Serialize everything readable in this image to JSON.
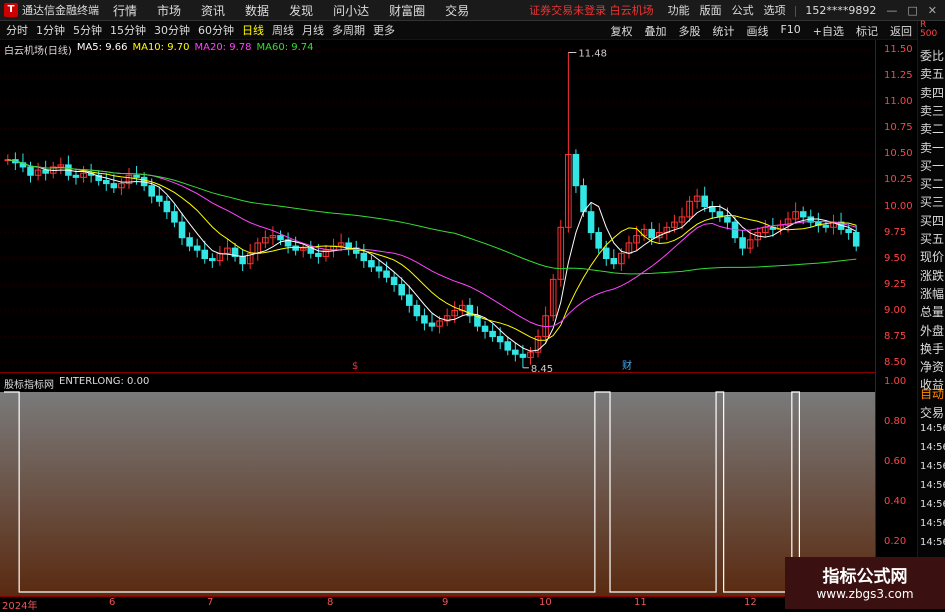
{
  "app": {
    "name": "通达信金融终端",
    "warning": "证券交易未登录",
    "stock_name_top": "白云机场"
  },
  "main_menu": [
    "行情",
    "市场",
    "资讯",
    "数据",
    "发现",
    "问小达",
    "财富圈",
    "交易"
  ],
  "right_menu": [
    "功能",
    "版面",
    "公式",
    "选项"
  ],
  "account": "152****9892",
  "toolbar": {
    "periods": [
      "分时",
      "1分钟",
      "5分钟",
      "15分钟",
      "30分钟",
      "60分钟",
      "日线",
      "周线",
      "月线",
      "多周期",
      "更多"
    ],
    "active": "日线",
    "right_buttons": [
      "复权",
      "叠加",
      "多股",
      "统计",
      "画线",
      "F10",
      "+自选",
      "标记",
      "返回"
    ]
  },
  "legend": {
    "name": "白云机场(日线)",
    "ma5": "MA5: 9.66",
    "ma10": "MA10: 9.70",
    "ma20": "MA20: 9.78",
    "ma60": "MA60: 9.74"
  },
  "sub_legend": {
    "name": "股标指标网",
    "value": "ENTERLONG: 0.00"
  },
  "annotations": {
    "high": "11.48",
    "low": "8.45",
    "marker1": "$",
    "marker2": "财"
  },
  "y_ticks": [
    "11.50",
    "11.25",
    "11.00",
    "10.75",
    "10.50",
    "10.25",
    "10.00",
    "9.75",
    "9.50",
    "9.25",
    "9.00",
    "8.75",
    "8.50"
  ],
  "sub_y_ticks": [
    "1.00",
    "0.80",
    "0.60",
    "0.40",
    "0.20"
  ],
  "x_ticks": [
    "2024年",
    "6",
    "7",
    "8",
    "9",
    "10",
    "11",
    "12"
  ],
  "side_panel": [
    "委比",
    "卖五",
    "卖四",
    "卖三",
    "卖二",
    "卖一",
    "买一",
    "买二",
    "买三",
    "买四",
    "买五",
    "现价",
    "涨跌",
    "涨幅",
    "总量",
    "外盘",
    "换手",
    "净资",
    "收益"
  ],
  "side_panel_lower": [
    "自动",
    "交易",
    "14:56",
    "14:56",
    "14:56",
    "14:56",
    "14:56",
    "14:56",
    "14:56",
    "14:56",
    "14:56",
    "14:56"
  ],
  "side_top": "R 500",
  "watermark": {
    "title": "指标公式网",
    "url": "www.zbgs3.com"
  },
  "colors": {
    "up": "#ff3333",
    "down": "#33e6e6",
    "ma5": "#ffffff",
    "ma10": "#ffff00",
    "ma20": "#ff44ff",
    "ma60": "#33dd33"
  },
  "chart_data": {
    "type": "candlestick",
    "ylim": [
      8.4,
      11.6
    ],
    "closes": [
      10.45,
      10.42,
      10.38,
      10.3,
      10.35,
      10.32,
      10.38,
      10.4,
      10.3,
      10.28,
      10.32,
      10.3,
      10.25,
      10.22,
      10.18,
      10.22,
      10.3,
      10.28,
      10.2,
      10.1,
      10.05,
      9.95,
      9.85,
      9.7,
      9.62,
      9.58,
      9.5,
      9.48,
      9.55,
      9.6,
      9.52,
      9.45,
      9.55,
      9.65,
      9.7,
      9.72,
      9.68,
      9.62,
      9.58,
      9.6,
      9.55,
      9.52,
      9.58,
      9.62,
      9.65,
      9.6,
      9.55,
      9.48,
      9.42,
      9.38,
      9.32,
      9.25,
      9.15,
      9.05,
      8.95,
      8.88,
      8.85,
      8.9,
      8.95,
      9.0,
      9.05,
      8.95,
      8.85,
      8.8,
      8.75,
      8.7,
      8.62,
      8.58,
      8.55,
      8.6,
      8.75,
      8.95,
      9.3,
      9.8,
      10.5,
      10.2,
      9.95,
      9.75,
      9.6,
      9.5,
      9.45,
      9.55,
      9.65,
      9.72,
      9.78,
      9.7,
      9.75,
      9.8,
      9.85,
      9.9,
      10.05,
      10.1,
      10.0,
      9.95,
      9.9,
      9.85,
      9.7,
      9.6,
      9.68,
      9.75,
      9.8,
      9.78,
      9.82,
      9.88,
      9.95,
      9.9,
      9.85,
      9.82,
      9.8,
      9.85,
      9.78,
      9.75,
      9.62
    ],
    "signal": [
      1,
      1,
      0,
      0,
      0,
      0,
      0,
      0,
      0,
      0,
      0,
      0,
      0,
      0,
      0,
      0,
      0,
      0,
      0,
      0,
      0,
      0,
      0,
      0,
      0,
      0,
      0,
      0,
      0,
      0,
      0,
      0,
      0,
      0,
      0,
      0,
      0,
      0,
      0,
      0,
      0,
      0,
      0,
      0,
      0,
      0,
      0,
      0,
      0,
      0,
      0,
      0,
      0,
      0,
      0,
      0,
      0,
      0,
      0,
      0,
      0,
      0,
      0,
      0,
      0,
      0,
      0,
      0,
      0,
      0,
      0,
      0,
      0,
      0,
      0,
      0,
      0,
      0,
      1,
      1,
      0,
      0,
      0,
      0,
      0,
      0,
      0,
      0,
      0,
      0,
      0,
      0,
      0,
      0,
      1,
      0,
      0,
      0,
      0,
      0,
      0,
      0,
      0,
      0,
      1,
      0,
      0,
      0,
      0,
      0,
      0,
      0,
      0
    ]
  }
}
